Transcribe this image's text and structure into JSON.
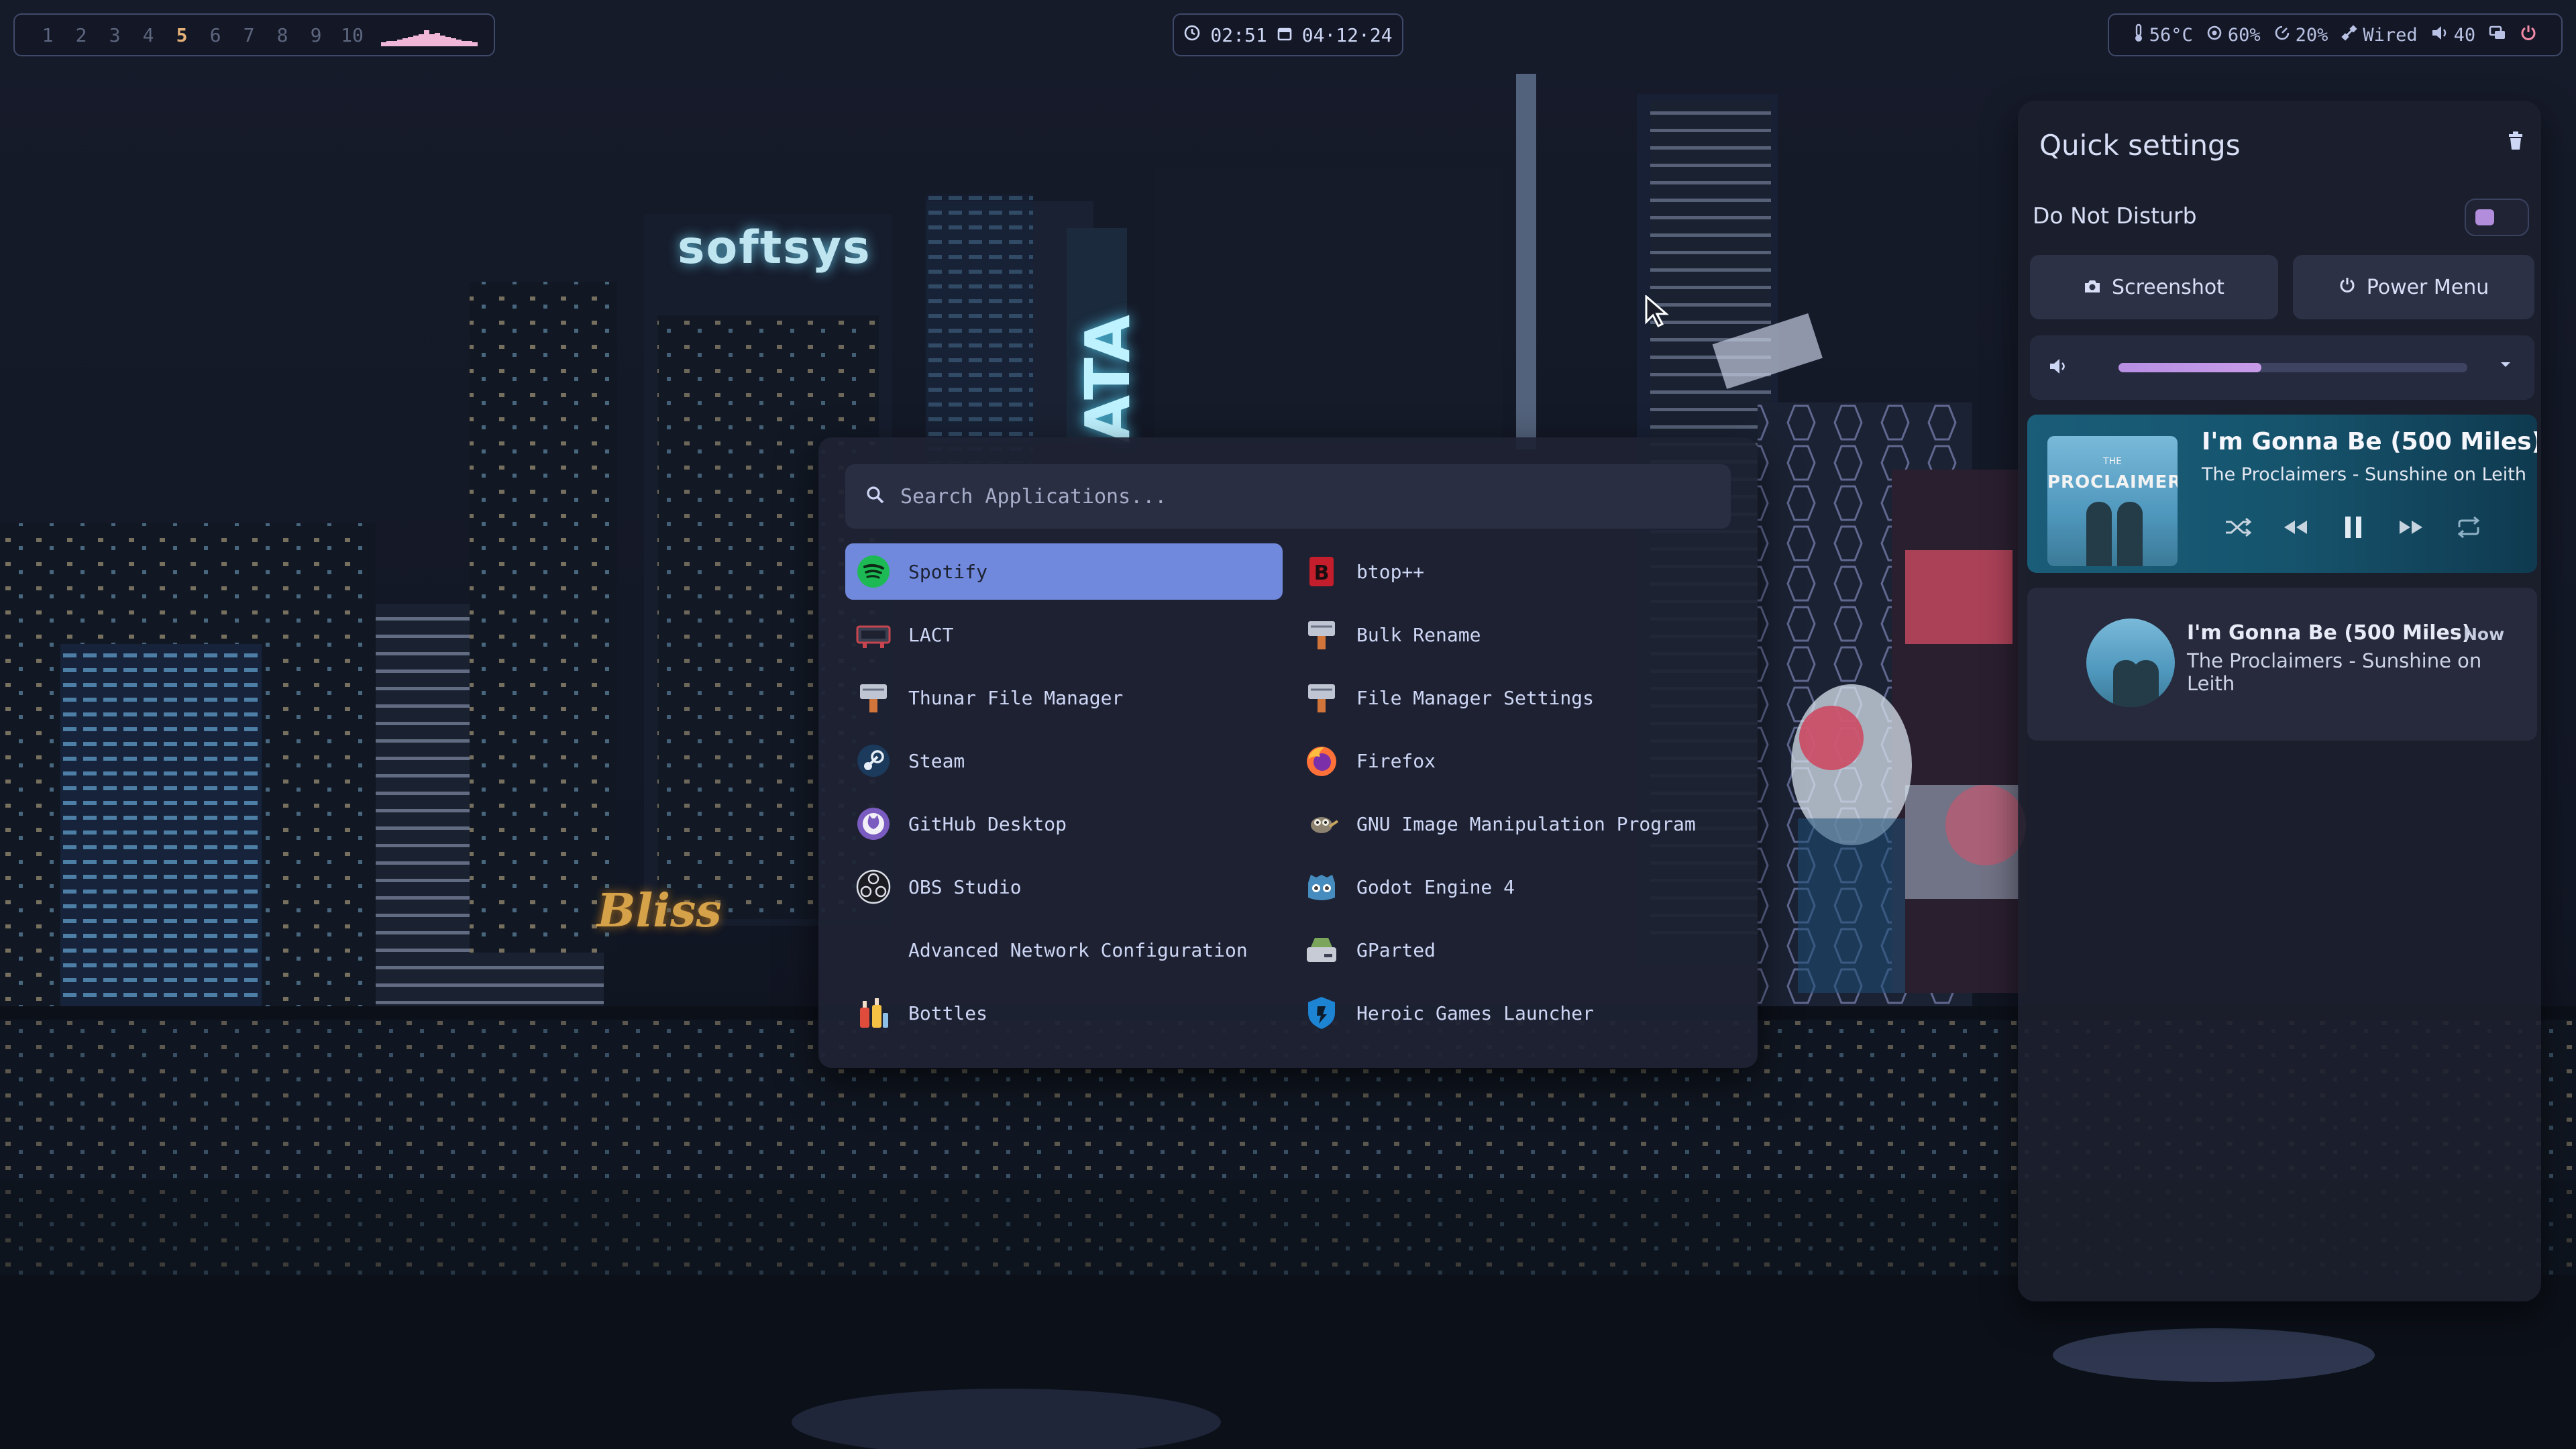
{
  "wallpaper": {
    "signs": [
      "softsys",
      "ATA",
      "Bliss"
    ]
  },
  "topbar": {
    "workspaces": [
      "1",
      "2",
      "3",
      "4",
      "5",
      "6",
      "7",
      "8",
      "9",
      "10"
    ],
    "active_workspace": "5",
    "clock": {
      "time": "02:51",
      "date": "04·12·24",
      "time_icon": "clock-icon",
      "date_icon": "calendar-icon"
    },
    "status": {
      "temperature": "56°C",
      "cpu": "60%",
      "memory": "20%",
      "network": "Wired",
      "volume": "40"
    }
  },
  "launcher": {
    "search_placeholder": "Search Applications...",
    "apps": [
      {
        "label": "Spotify",
        "icon": "spotify-icon",
        "selected": true
      },
      {
        "label": "btop++",
        "icon": "btop-icon"
      },
      {
        "label": "LACT",
        "icon": "lact-icon"
      },
      {
        "label": "Bulk Rename",
        "icon": "bulk-rename-icon"
      },
      {
        "label": "Thunar File Manager",
        "icon": "thunar-icon"
      },
      {
        "label": "File Manager Settings",
        "icon": "file-manager-settings-icon"
      },
      {
        "label": "Steam",
        "icon": "steam-icon"
      },
      {
        "label": "Firefox",
        "icon": "firefox-icon"
      },
      {
        "label": "GitHub Desktop",
        "icon": "github-icon"
      },
      {
        "label": "GNU Image Manipulation Program",
        "icon": "gimp-icon"
      },
      {
        "label": "OBS Studio",
        "icon": "obs-icon"
      },
      {
        "label": "Godot Engine 4",
        "icon": "godot-icon"
      },
      {
        "label": "Advanced Network Configuration",
        "icon": ""
      },
      {
        "label": "GParted",
        "icon": "gparted-icon"
      },
      {
        "label": "Bottles",
        "icon": "bottles-icon"
      },
      {
        "label": "Heroic Games Launcher",
        "icon": "heroic-icon"
      }
    ]
  },
  "quick_settings": {
    "title": "Quick settings",
    "dnd_label": "Do Not Disturb",
    "dnd_enabled": false,
    "screenshot_label": "Screenshot",
    "power_menu_label": "Power Menu",
    "volume_level": 0.41,
    "media": {
      "title": "I'm Gonna Be (500 Miles)",
      "artist_album": "The Proclaimers - Sunshine on Leith",
      "album_art_text": "PROCLAIMERS",
      "album_art_small": "THE",
      "playing": true
    },
    "notification": {
      "title": "I'm Gonna Be (500 Miles)",
      "time": "Now",
      "body": "The Proclaimers - Sunshine on Leith"
    }
  },
  "colors": {
    "accent": "#7089dd",
    "toggle": "#b18ddc",
    "danger": "#f38ba8",
    "workspace_active": "#e5b178"
  }
}
